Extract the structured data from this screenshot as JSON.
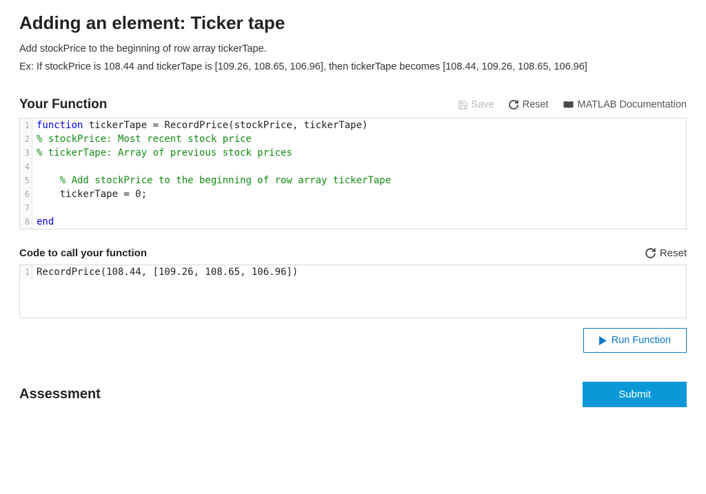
{
  "title": "Adding an element: Ticker tape",
  "description1": "Add stockPrice to the beginning of row array tickerTape.",
  "description2": "Ex: If stockPrice is 108.44 and tickerTape is [109.26, 108.65, 106.96], then tickerTape becomes [108.44, 109.26, 108.65, 106.96]",
  "your_function_label": "Your Function",
  "toolbar": {
    "save": "Save",
    "reset": "Reset",
    "docs": "MATLAB Documentation"
  },
  "function_code": {
    "lines": [
      {
        "n": "1",
        "kw": "function",
        "rest": " tickerTape = RecordPrice(stockPrice, tickerTape)"
      },
      {
        "n": "2",
        "com": "% stockPrice: Most recent stock price"
      },
      {
        "n": "3",
        "com": "% tickerTape: Array of previous stock prices"
      },
      {
        "n": "4",
        "blank": ""
      },
      {
        "n": "5",
        "indent": "    ",
        "com": "% Add stockPrice to the beginning of row array tickerTape"
      },
      {
        "n": "6",
        "plain": "    tickerTape = 0;"
      },
      {
        "n": "7",
        "blank": ""
      },
      {
        "n": "8",
        "kw": "end"
      }
    ]
  },
  "call_label": "Code to call your function",
  "reset2": "Reset",
  "call_code": {
    "n": "1",
    "text": "RecordPrice(108.44, [109.26, 108.65, 106.96])"
  },
  "run_label": "Run Function",
  "assessment_label": "Assessment",
  "submit_label": "Submit"
}
